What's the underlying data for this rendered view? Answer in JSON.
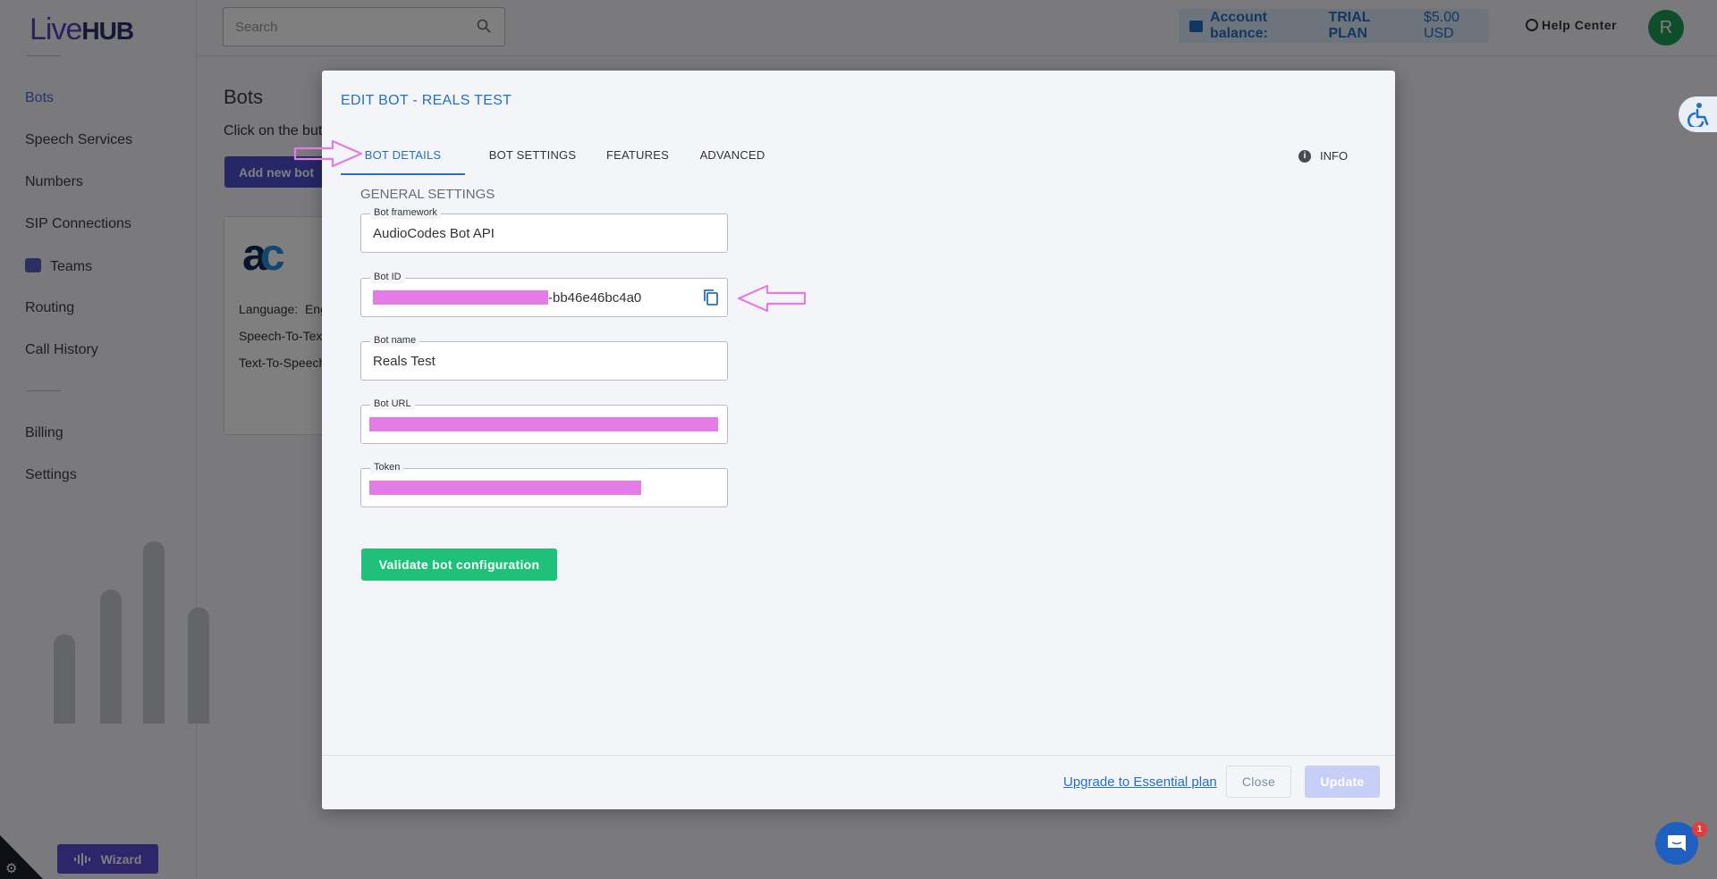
{
  "app": {
    "logo": {
      "part1": "Live",
      "part2": "HUB"
    }
  },
  "sidebar": {
    "items": [
      {
        "label": "Bots"
      },
      {
        "label": "Speech Services"
      },
      {
        "label": "Numbers"
      },
      {
        "label": "SIP Connections"
      },
      {
        "label": "Teams"
      },
      {
        "label": "Routing"
      },
      {
        "label": "Call History"
      },
      {
        "label": "Billing"
      },
      {
        "label": "Settings"
      }
    ],
    "wizard_label": "Wizard"
  },
  "topbar": {
    "search_placeholder": "Search",
    "balance_label": "Account balance:",
    "balance_plan": "TRIAL PLAN",
    "balance_amount": "$5.00 USD",
    "help_label": "Help Center",
    "avatar_initial": "R"
  },
  "page": {
    "title": "Bots",
    "subtitle": "Click on the butt",
    "add_button": "Add new bot",
    "card": {
      "logo": "ac",
      "language_label": "Language:",
      "language_value": "Eng",
      "stt_label": "Speech-To-Tex",
      "tts_label": "Text-To-Speech"
    }
  },
  "modal": {
    "title": "EDIT BOT - REALS TEST",
    "tabs": [
      {
        "label": "BOT DETAILS",
        "active": true
      },
      {
        "label": "BOT SETTINGS",
        "active": false
      },
      {
        "label": "FEATURES",
        "active": false
      },
      {
        "label": "ADVANCED",
        "active": false
      }
    ],
    "info_label": "INFO",
    "section_title": "GENERAL SETTINGS",
    "fields": {
      "framework": {
        "label": "Bot framework",
        "value": "AudioCodes Bot API"
      },
      "bot_id": {
        "label": "Bot ID",
        "value_visible": "-bb46e46bc4a0"
      },
      "bot_name": {
        "label": "Bot name",
        "value": "Reals Test"
      },
      "bot_url": {
        "label": "Bot URL"
      },
      "token": {
        "label": "Token"
      }
    },
    "validate_button": "Validate bot configuration",
    "footer": {
      "upgrade_link": "Upgrade to Essential plan",
      "close_button": "Close",
      "update_button": "Update"
    }
  },
  "chat": {
    "badge_count": "1"
  },
  "colors": {
    "accent_blue": "#2470c4",
    "validate_green": "#21c07a",
    "annotation_pink": "#e57be6",
    "update_disabled": "#c7cff7"
  }
}
